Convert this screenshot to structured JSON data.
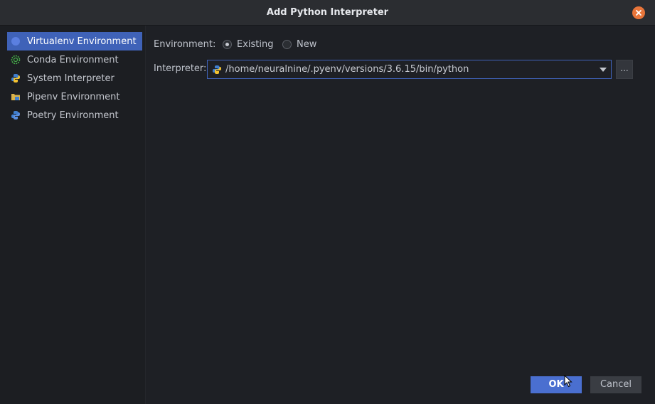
{
  "dialog": {
    "title": "Add Python Interpreter",
    "close_icon": "close-icon"
  },
  "sidebar": {
    "items": [
      {
        "label": "Virtualenv Environment",
        "icon": "virtualenv-icon",
        "selected": true
      },
      {
        "label": "Conda Environment",
        "icon": "conda-icon",
        "selected": false
      },
      {
        "label": "System Interpreter",
        "icon": "python-icon",
        "selected": false
      },
      {
        "label": "Pipenv Environment",
        "icon": "pipenv-folder-icon",
        "selected": false
      },
      {
        "label": "Poetry Environment",
        "icon": "poetry-icon",
        "selected": false
      }
    ]
  },
  "form": {
    "environment_label": "Environment:",
    "env_options": [
      {
        "label": "Existing",
        "checked": true
      },
      {
        "label": "New",
        "checked": false
      }
    ],
    "interpreter_label": "Interpreter:",
    "interpreter_value": "/home/neuralnine/.pyenv/versions/3.6.15/bin/python",
    "browse_label": "..."
  },
  "footer": {
    "ok_label": "OK",
    "cancel_label": "Cancel"
  },
  "colors": {
    "accent": "#4a6fd0",
    "selection": "#3f62b8",
    "close": "#e8753a",
    "background": "#1e2025"
  }
}
